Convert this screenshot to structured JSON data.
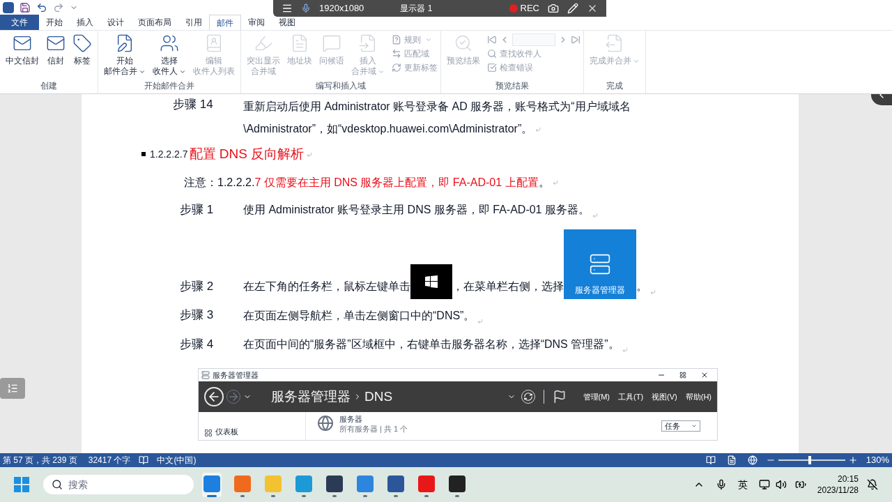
{
  "recorder_bar": {
    "resolution": "1920x1080",
    "display": "显示器 1",
    "rec": "REC"
  },
  "tabs": [
    {
      "label": "文件",
      "kind": "file",
      "selected": false
    },
    {
      "label": "开始",
      "kind": "tab",
      "selected": false
    },
    {
      "label": "插入",
      "kind": "tab",
      "selected": false
    },
    {
      "label": "设计",
      "kind": "tab",
      "selected": false
    },
    {
      "label": "页面布局",
      "kind": "tab",
      "selected": false
    },
    {
      "label": "引用",
      "kind": "tab",
      "selected": false
    },
    {
      "label": "邮件",
      "kind": "tab",
      "selected": true
    },
    {
      "label": "审阅",
      "kind": "tab",
      "selected": false
    },
    {
      "label": "视图",
      "kind": "tab",
      "selected": false
    }
  ],
  "ribbon_groups": [
    {
      "label": "创建",
      "large": [
        {
          "lines": [
            "中文信封"
          ],
          "disabled": false,
          "dropdown": false
        },
        {
          "lines": [
            "信封"
          ],
          "disabled": false,
          "dropdown": false
        },
        {
          "lines": [
            "标签"
          ],
          "disabled": false,
          "dropdown": false
        }
      ]
    },
    {
      "label": "开始邮件合并",
      "large": [
        {
          "lines": [
            "开始",
            "邮件合并"
          ],
          "disabled": false,
          "dropdown": true
        },
        {
          "lines": [
            "选择",
            "收件人"
          ],
          "disabled": false,
          "dropdown": true
        },
        {
          "lines": [
            "编辑",
            "收件人列表"
          ],
          "disabled": true,
          "dropdown": false
        }
      ]
    },
    {
      "label": "编写和插入域",
      "large": [
        {
          "lines": [
            "突出显示",
            "合并域"
          ],
          "disabled": true,
          "dropdown": false
        },
        {
          "lines": [
            "地址块"
          ],
          "disabled": true,
          "dropdown": false
        },
        {
          "lines": [
            "问候语"
          ],
          "disabled": true,
          "dropdown": false
        },
        {
          "lines": [
            "插入",
            "合并域"
          ],
          "disabled": true,
          "dropdown": true
        }
      ],
      "small": [
        {
          "label": "规则",
          "disabled": true,
          "dropdown": true
        },
        {
          "label": "匹配域",
          "disabled": true,
          "dropdown": false
        },
        {
          "label": "更新标签",
          "disabled": true,
          "dropdown": false
        }
      ]
    },
    {
      "label": "预览结果",
      "large": [
        {
          "lines": [
            "预览结果"
          ],
          "disabled": true,
          "dropdown": false
        }
      ],
      "record_nav": {
        "disabled": true
      },
      "small": [
        {
          "label": "查找收件人",
          "disabled": true,
          "dropdown": false
        },
        {
          "label": "检查错误",
          "disabled": true,
          "dropdown": false
        }
      ]
    },
    {
      "label": "完成",
      "large": [
        {
          "lines": [
            "完成并合并"
          ],
          "disabled": true,
          "dropdown": true
        }
      ]
    }
  ],
  "document": {
    "step_14": {
      "label": "步骤 14",
      "text": "重新启动后使用 Administrator 账号登录备 AD 服务器，账号格式为“用户域域名\\Administrator”，如“vdesktop.huawei.com\\Administrator”。"
    },
    "heading": {
      "number": "1.2.2.2.7",
      "title": "配置 DNS 反向解析"
    },
    "note": {
      "segments": [
        {
          "text": "注意：",
          "red": false
        },
        {
          "text": "1.2.2.2.",
          "red": false
        },
        {
          "text": "7 仅需要在主用 DNS 服务器上配置，即 FA-AD-01 上配置",
          "red": true
        },
        {
          "text": "。",
          "red": false
        }
      ]
    },
    "steps": [
      {
        "label": "步骤 1",
        "parts": [
          {
            "kind": "text",
            "text": "使用 Administrator 账号登录主用 DNS 服务器，即 FA-AD-01 服务器。"
          }
        ]
      },
      {
        "label": "步骤 2",
        "parts": [
          {
            "kind": "text",
            "text": "在左下角的任务栏，鼠标左键单击"
          },
          {
            "kind": "start_image"
          },
          {
            "kind": "text",
            "text": "，在菜单栏右侧，选择"
          },
          {
            "kind": "tile_image",
            "text": "服务器管理器"
          },
          {
            "kind": "text",
            "text": "。"
          }
        ]
      },
      {
        "label": "步骤 3",
        "parts": [
          {
            "kind": "text",
            "text": "在页面左侧导航栏，单击左侧窗口中的“DNS”。"
          }
        ]
      },
      {
        "label": "步骤 4",
        "parts": [
          {
            "kind": "text",
            "text": "在页面中间的“服务器”区域框中，右键单击服务器名称，选择“DNS 管理器”。"
          }
        ]
      }
    ],
    "server_manager": {
      "title": "服务器管理器",
      "breadcrumb": [
        "服务器管理器",
        "DNS"
      ],
      "menus": [
        "管理(M)",
        "工具(T)",
        "视图(V)",
        "帮助(H)"
      ],
      "nav_item": "仪表板",
      "section_title": "服务器",
      "section_subtitle": "所有服务器 | 共 1 个",
      "tasks": "任务"
    }
  },
  "status_bar": {
    "page": "第 57 页，共 239 页",
    "words": "32417 个字",
    "language": "中文(中国)",
    "zoom": "130%",
    "level": 0.47
  },
  "taskbar": {
    "search_placeholder": "搜索",
    "apps": [
      {
        "selected": true
      },
      {
        "selected": false
      },
      {
        "selected": false
      },
      {
        "selected": false
      },
      {
        "selected": false
      },
      {
        "selected": false
      },
      {
        "selected": false
      },
      {
        "selected": false
      },
      {
        "selected": false
      }
    ],
    "time": "20:15",
    "date": "2023/11/28",
    "ime": "英"
  }
}
